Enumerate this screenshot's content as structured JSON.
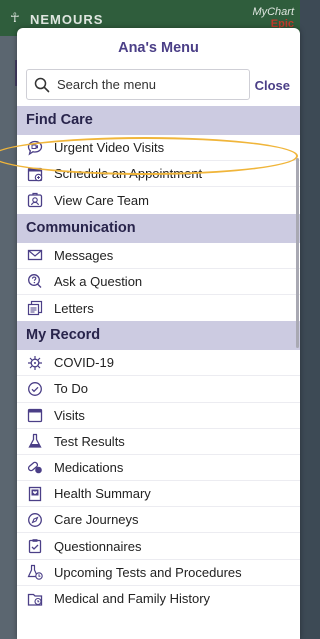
{
  "background": {
    "logo_text": "NEMOURS",
    "mychart_text": "MyChart",
    "mychart_sub": "Epic"
  },
  "menu": {
    "title": "Ana's Menu",
    "search": {
      "placeholder": "Search the menu",
      "value": ""
    },
    "close_label": "Close",
    "sections": [
      {
        "title": "Find Care",
        "items": [
          {
            "label": "Urgent Video Visits",
            "icon": "video-chat-icon"
          },
          {
            "label": "Schedule an Appointment",
            "icon": "calendar-plus-icon"
          },
          {
            "label": "View Care Team",
            "icon": "care-team-icon"
          }
        ]
      },
      {
        "title": "Communication",
        "items": [
          {
            "label": "Messages",
            "icon": "envelope-icon"
          },
          {
            "label": "Ask a Question",
            "icon": "question-chat-icon"
          },
          {
            "label": "Letters",
            "icon": "letters-icon"
          }
        ]
      },
      {
        "title": "My Record",
        "items": [
          {
            "label": "COVID-19",
            "icon": "virus-icon"
          },
          {
            "label": "To Do",
            "icon": "clock-check-icon"
          },
          {
            "label": "Visits",
            "icon": "calendar-icon"
          },
          {
            "label": "Test Results",
            "icon": "flask-icon"
          },
          {
            "label": "Medications",
            "icon": "pills-icon"
          },
          {
            "label": "Health Summary",
            "icon": "heart-card-icon"
          },
          {
            "label": "Care Journeys",
            "icon": "compass-icon"
          },
          {
            "label": "Questionnaires",
            "icon": "clipboard-check-icon"
          },
          {
            "label": "Upcoming Tests and Procedures",
            "icon": "upcoming-flask-icon"
          },
          {
            "label": "Medical and Family History",
            "icon": "folder-clock-icon"
          }
        ]
      }
    ]
  },
  "colors": {
    "accent": "#4b3f87",
    "section_bg": "#cccbe1",
    "highlight": "#f0b53a"
  }
}
